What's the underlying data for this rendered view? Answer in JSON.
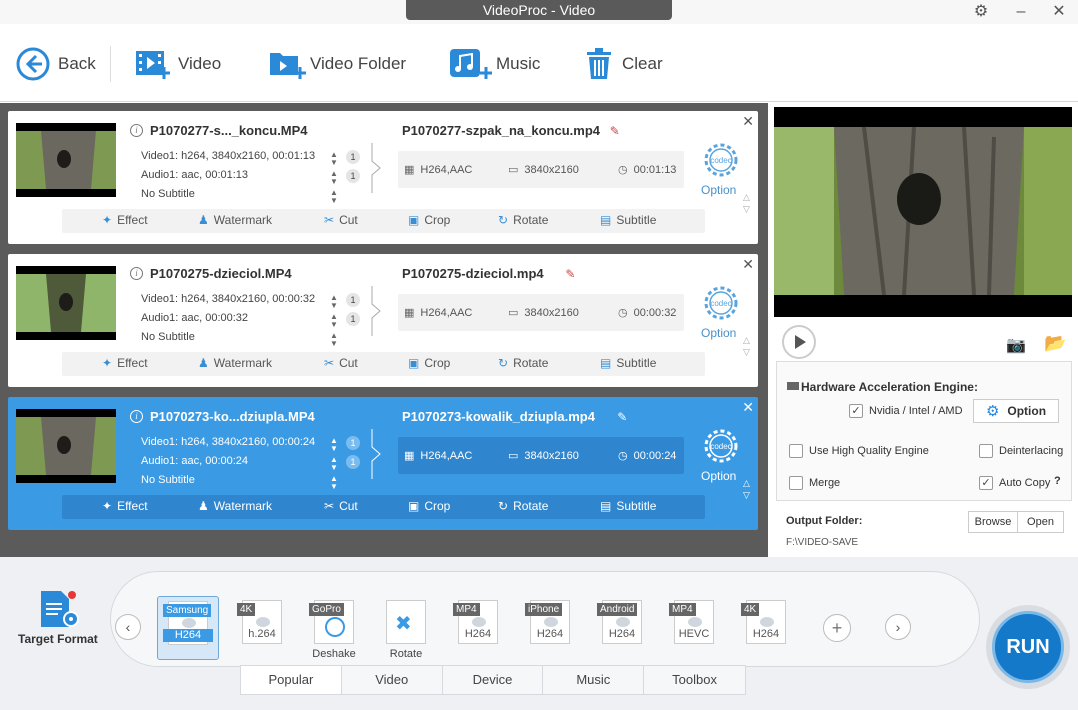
{
  "window": {
    "title": "VideoProc - Video"
  },
  "toolbar": {
    "back": "Back",
    "video": "Video",
    "video_folder": "Video Folder",
    "music": "Music",
    "clear": "Clear"
  },
  "items": [
    {
      "source_name": "P1070277-s..._koncu.MP4",
      "output_name": "P1070277-szpak_na_koncu.mp4",
      "video_track": "Video1: h264, 3840x2160, 00:01:13",
      "audio_track": "Audio1: aac, 00:01:13",
      "subtitle": "No Subtitle",
      "video_count": "1",
      "audio_count": "1",
      "codec": "H264,AAC",
      "resolution": "3840x2160",
      "duration": "00:01:13",
      "option": "Option",
      "selected": false
    },
    {
      "source_name": "P1070275-dzieciol.MP4",
      "output_name": "P1070275-dzieciol.mp4",
      "video_track": "Video1: h264, 3840x2160, 00:00:32",
      "audio_track": "Audio1: aac, 00:00:32",
      "subtitle": "No Subtitle",
      "video_count": "1",
      "audio_count": "1",
      "codec": "H264,AAC",
      "resolution": "3840x2160",
      "duration": "00:00:32",
      "option": "Option",
      "selected": false
    },
    {
      "source_name": "P1070273-ko...dziupla.MP4",
      "output_name": "P1070273-kowalik_dziupla.mp4",
      "video_track": "Video1: h264, 3840x2160, 00:00:24",
      "audio_track": "Audio1: aac, 00:00:24",
      "subtitle": "No Subtitle",
      "video_count": "1",
      "audio_count": "1",
      "codec": "H264,AAC",
      "resolution": "3840x2160",
      "duration": "00:00:24",
      "option": "Option",
      "selected": true
    }
  ],
  "actions": {
    "effect": "Effect",
    "watermark": "Watermark",
    "cut": "Cut",
    "crop": "Crop",
    "rotate": "Rotate",
    "subtitle": "Subtitle"
  },
  "settings": {
    "hw_title": "Hardware Acceleration Engine:",
    "nvidia": "Nvidia / Intel / AMD",
    "nvidia_checked": true,
    "option_btn": "Option",
    "high_quality": "Use High Quality Engine",
    "high_quality_checked": false,
    "deinterlacing": "Deinterlacing",
    "deinterlacing_checked": false,
    "merge": "Merge",
    "merge_checked": false,
    "auto_copy": "Auto Copy",
    "auto_copy_checked": true,
    "help": "?"
  },
  "output": {
    "title": "Output Folder:",
    "path": "F:\\VIDEO-SAVE",
    "browse": "Browse",
    "open": "Open"
  },
  "target": {
    "label": "Target Format"
  },
  "formats": [
    {
      "tag": "Samsung",
      "sub": "H264",
      "caption": "",
      "selected": true
    },
    {
      "tag": "4K",
      "sub": "h.264",
      "caption": "",
      "selected": false
    },
    {
      "tag": "GoPro",
      "sub": "",
      "caption": "Deshake",
      "selected": false
    },
    {
      "tag": "",
      "sub": "",
      "caption": "Rotate",
      "selected": false
    },
    {
      "tag": "MP4",
      "sub": "H264",
      "caption": "",
      "selected": false
    },
    {
      "tag": "iPhone",
      "sub": "H264",
      "caption": "",
      "selected": false
    },
    {
      "tag": "Android",
      "sub": "H264",
      "caption": "",
      "selected": false
    },
    {
      "tag": "MP4",
      "sub": "HEVC",
      "caption": "",
      "selected": false
    },
    {
      "tag": "4K",
      "sub": "H264",
      "caption": "",
      "selected": false
    }
  ],
  "tabs": [
    "Popular",
    "Video",
    "Device",
    "Music",
    "Toolbox"
  ],
  "active_tab": "Popular",
  "run": "RUN",
  "colors": {
    "accent": "#3b9ae4",
    "run": "#1479c9",
    "list_bg": "#5b5b5b"
  }
}
